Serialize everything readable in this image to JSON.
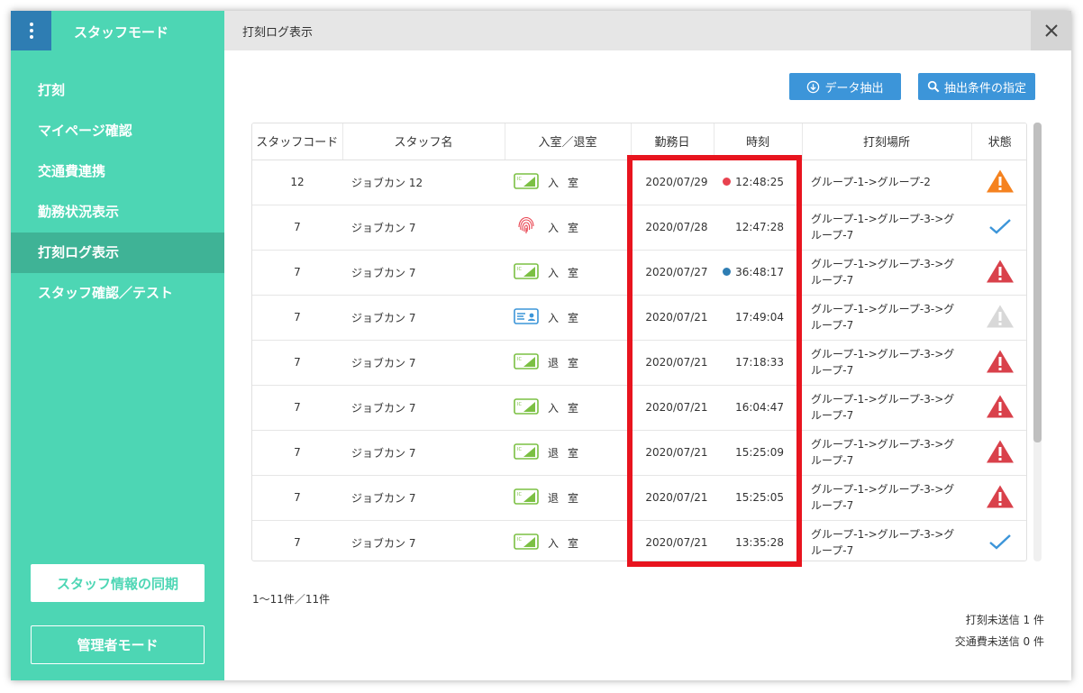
{
  "sidebar": {
    "title": "スタッフモード",
    "nav": [
      {
        "label": "打刻",
        "active": false
      },
      {
        "label": "マイページ確認",
        "active": false
      },
      {
        "label": "交通費連携",
        "active": false
      },
      {
        "label": "勤務状況表示",
        "active": false
      },
      {
        "label": "打刻ログ表示",
        "active": true
      },
      {
        "label": "スタッフ確認／テスト",
        "active": false
      }
    ],
    "sync_button": "スタッフ情報の同期",
    "admin_button": "管理者モード"
  },
  "header": {
    "title": "打刻ログ表示"
  },
  "actions": {
    "export_label": "データ抽出",
    "filter_label": "抽出条件の指定"
  },
  "table": {
    "columns": [
      "スタッフコード",
      "スタッフ名",
      "入室／退室",
      "勤務日",
      "時刻",
      "打刻場所",
      "状態"
    ],
    "rows": [
      {
        "code": "12",
        "name": "ジョブカン 12",
        "method": "ic-card",
        "inout": "入室",
        "date": "2020/07/29",
        "dot": "#e8424f",
        "time": "12:48:25",
        "place": "グループ-1->グループ-2",
        "status": "warning-orange"
      },
      {
        "code": "7",
        "name": "ジョブカン 7",
        "method": "fingerprint",
        "inout": "入室",
        "date": "2020/07/28",
        "dot": null,
        "time": "12:47:28",
        "place": "グループ-1->グループ-3->グループ-7",
        "status": "check"
      },
      {
        "code": "7",
        "name": "ジョブカン 7",
        "method": "ic-card",
        "inout": "入室",
        "date": "2020/07/27",
        "dot": "#2e7db3",
        "time": "36:48:17",
        "place": "グループ-1->グループ-3->グループ-7",
        "status": "warning-red"
      },
      {
        "code": "7",
        "name": "ジョブカン 7",
        "method": "staff-card",
        "inout": "入室",
        "date": "2020/07/21",
        "dot": null,
        "time": "17:49:04",
        "place": "グループ-1->グループ-3->グループ-7",
        "status": "warning-gray"
      },
      {
        "code": "7",
        "name": "ジョブカン 7",
        "method": "ic-card",
        "inout": "退室",
        "date": "2020/07/21",
        "dot": null,
        "time": "17:18:33",
        "place": "グループ-1->グループ-3->グループ-7",
        "status": "warning-red"
      },
      {
        "code": "7",
        "name": "ジョブカン 7",
        "method": "ic-card",
        "inout": "入室",
        "date": "2020/07/21",
        "dot": null,
        "time": "16:04:47",
        "place": "グループ-1->グループ-3->グループ-7",
        "status": "warning-red"
      },
      {
        "code": "7",
        "name": "ジョブカン 7",
        "method": "ic-card",
        "inout": "退室",
        "date": "2020/07/21",
        "dot": null,
        "time": "15:25:09",
        "place": "グループ-1->グループ-3->グループ-7",
        "status": "warning-red"
      },
      {
        "code": "7",
        "name": "ジョブカン 7",
        "method": "ic-card",
        "inout": "退室",
        "date": "2020/07/21",
        "dot": null,
        "time": "15:25:05",
        "place": "グループ-1->グループ-3->グループ-7",
        "status": "warning-red"
      },
      {
        "code": "7",
        "name": "ジョブカン 7",
        "method": "ic-card",
        "inout": "入室",
        "date": "2020/07/21",
        "dot": null,
        "time": "13:35:28",
        "place": "グループ-1->グループ-3->グループ-7",
        "status": "check"
      }
    ]
  },
  "footer": {
    "count_text": "1〜11件／11件",
    "pending_punch": "打刻未送信 1 件",
    "pending_transport": "交通費未送信 0 件"
  },
  "colors": {
    "sidebar": "#4dd6b4",
    "accent_blue": "#3c95d9",
    "highlight": "#e8141e"
  }
}
